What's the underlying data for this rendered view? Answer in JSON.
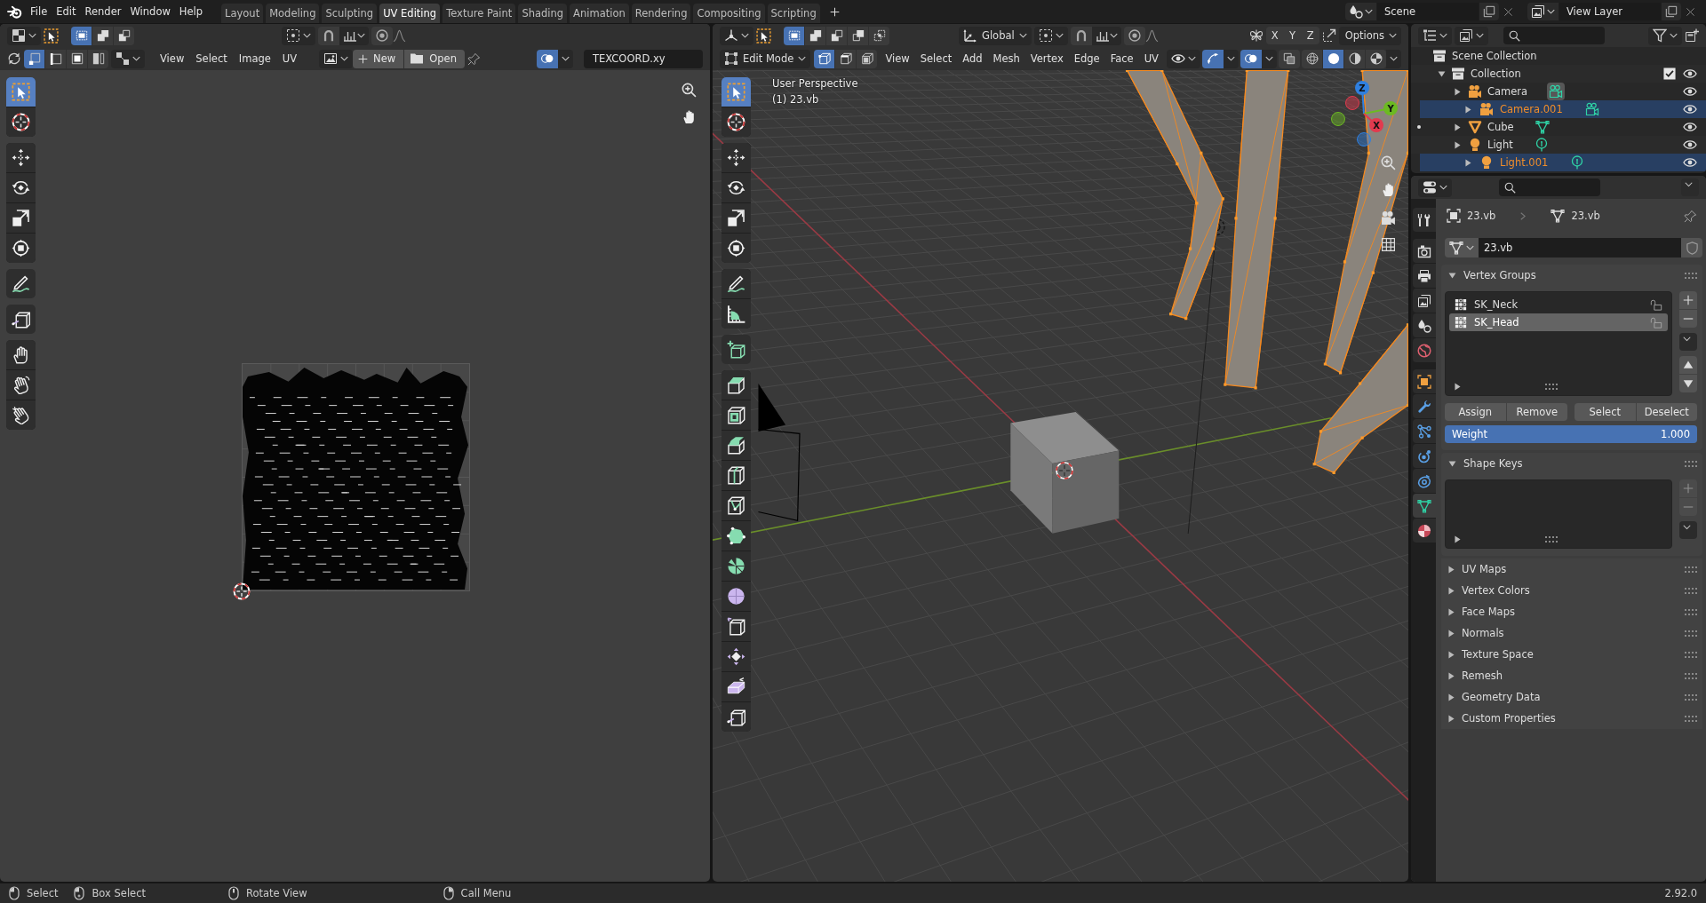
{
  "topbar": {
    "menus": [
      "File",
      "Edit",
      "Render",
      "Window",
      "Help"
    ],
    "workspaces": [
      {
        "label": "Layout",
        "selected": false
      },
      {
        "label": "Modeling",
        "selected": false
      },
      {
        "label": "Sculpting",
        "selected": false
      },
      {
        "label": "UV Editing",
        "selected": true
      },
      {
        "label": "Texture Paint",
        "selected": false
      },
      {
        "label": "Shading",
        "selected": false
      },
      {
        "label": "Animation",
        "selected": false
      },
      {
        "label": "Rendering",
        "selected": false
      },
      {
        "label": "Compositing",
        "selected": false
      },
      {
        "label": "Scripting",
        "selected": false
      }
    ],
    "scene": "Scene",
    "view_layer": "View Layer"
  },
  "uv_editor": {
    "select_modes": [
      {
        "kind": "set",
        "selected": true
      },
      {
        "kind": "extend",
        "selected": false
      },
      {
        "kind": "subtract",
        "selected": false
      }
    ],
    "uv_select_modes": [
      {
        "kind": "vertex",
        "selected": true
      },
      {
        "kind": "edge",
        "selected": false
      },
      {
        "kind": "face",
        "selected": false
      },
      {
        "kind": "island",
        "selected": false
      }
    ],
    "menus": [
      "View",
      "Select",
      "Image",
      "UV"
    ],
    "new_button": "New",
    "open_button": "Open",
    "overlays_on": true,
    "uv_map": "TEXCOORD.xy",
    "tool_groups": [
      {
        "tools": [
          {
            "kind": "select_box",
            "selected": true
          },
          {
            "kind": "cursor",
            "selected": false
          }
        ]
      },
      {
        "tools": [
          {
            "kind": "move",
            "selected": false
          },
          {
            "kind": "rotate",
            "selected": false
          },
          {
            "kind": "scale",
            "selected": false
          },
          {
            "kind": "transform",
            "selected": false
          }
        ]
      },
      {
        "tools": [
          {
            "kind": "annotate",
            "selected": false
          }
        ]
      },
      {
        "tools": [
          {
            "kind": "rip_region",
            "selected": false
          }
        ]
      },
      {
        "tools": [
          {
            "kind": "grab",
            "selected": false
          },
          {
            "kind": "relax",
            "selected": false
          },
          {
            "kind": "pinch",
            "selected": false
          }
        ]
      }
    ]
  },
  "viewport": {
    "select_modes": [
      {
        "kind": "set",
        "selected": true
      },
      {
        "kind": "extend",
        "selected": false
      },
      {
        "kind": "subtract",
        "selected": false
      },
      {
        "kind": "invert",
        "selected": false
      },
      {
        "kind": "intersect",
        "selected": false
      }
    ],
    "orientation": "Global",
    "mirror_axes": [
      {
        "label": "X",
        "on": false
      },
      {
        "label": "Y",
        "on": false
      },
      {
        "label": "Z",
        "on": false
      }
    ],
    "options": "Options",
    "mode": "Edit Mode",
    "mesh_select_modes": [
      {
        "kind": "vertex",
        "selected": true
      },
      {
        "kind": "edge",
        "selected": false
      },
      {
        "kind": "face",
        "selected": false
      }
    ],
    "menus": [
      "View",
      "Select",
      "Add",
      "Mesh",
      "Vertex",
      "Edge",
      "Face",
      "UV"
    ],
    "toggles": [
      {
        "kind": "gizmo",
        "on": true
      },
      {
        "kind": "overlays",
        "on": true
      },
      {
        "kind": "xray",
        "on": false
      }
    ],
    "shading_modes": [
      {
        "kind": "wireframe",
        "selected": false
      },
      {
        "kind": "solid",
        "selected": true
      },
      {
        "kind": "material",
        "selected": false
      },
      {
        "kind": "rendered",
        "selected": false
      }
    ],
    "view_name": "User Perspective",
    "object_info": "(1) 23.vb",
    "gizmo_axes": [
      {
        "kind": "z",
        "label": "Z",
        "color": "#2f80e0"
      },
      {
        "kind": "y",
        "label": "Y",
        "color": "#6cba22"
      },
      {
        "kind": "x",
        "label": "X",
        "color": "#e23a4e"
      }
    ],
    "tool_groups": [
      {
        "tools": [
          {
            "kind": "select_box",
            "selected": true
          },
          {
            "kind": "cursor",
            "selected": false
          }
        ]
      },
      {
        "tools": [
          {
            "kind": "move",
            "selected": false
          },
          {
            "kind": "rotate",
            "selected": false
          },
          {
            "kind": "scale",
            "selected": false
          },
          {
            "kind": "transform",
            "selected": false
          }
        ]
      },
      {
        "tools": [
          {
            "kind": "annotate",
            "selected": false
          },
          {
            "kind": "measure",
            "selected": false
          }
        ]
      },
      {
        "tools": [
          {
            "kind": "add_cube",
            "selected": false
          }
        ]
      },
      {
        "tools": [
          {
            "kind": "extrude",
            "selected": false
          },
          {
            "kind": "inset",
            "selected": false
          },
          {
            "kind": "bevel",
            "selected": false
          },
          {
            "kind": "loop_cut",
            "selected": false
          },
          {
            "kind": "knife",
            "selected": false
          },
          {
            "kind": "poly_build",
            "selected": false
          },
          {
            "kind": "spin",
            "selected": false
          },
          {
            "kind": "smooth",
            "selected": false
          },
          {
            "kind": "edge_slide",
            "selected": false
          },
          {
            "kind": "shrink_fatten",
            "selected": false
          },
          {
            "kind": "shear",
            "selected": false
          },
          {
            "kind": "rip_region",
            "selected": false
          }
        ]
      }
    ]
  },
  "outliner": {
    "root": "Scene Collection",
    "collections": [
      {
        "name": "Collection",
        "checked": true,
        "expanded": true,
        "children": [
          {
            "name": "Camera",
            "kind": "camera",
            "selected": false,
            "expanded": false,
            "mode_toggle": false,
            "active_data": true
          },
          {
            "name": "Camera.001",
            "kind": "camera",
            "selected": true,
            "expanded": false,
            "mode_toggle": false,
            "active_data": false
          },
          {
            "name": "Cube",
            "kind": "mesh",
            "selected": false,
            "expanded": false,
            "mode_toggle": true,
            "active_data": false
          },
          {
            "name": "Light",
            "kind": "light",
            "selected": false,
            "expanded": false,
            "mode_toggle": false,
            "active_data": false
          },
          {
            "name": "Light.001",
            "kind": "light",
            "selected": true,
            "expanded": false,
            "mode_toggle": false,
            "active_data": false
          }
        ]
      }
    ]
  },
  "properties": {
    "tab_groups": [
      {
        "tabs": [
          {
            "kind": "tool",
            "selected": false
          }
        ]
      },
      {
        "tabs": [
          {
            "kind": "render",
            "selected": false
          },
          {
            "kind": "output",
            "selected": false
          },
          {
            "kind": "view_layer",
            "selected": false
          },
          {
            "kind": "scene",
            "selected": false
          },
          {
            "kind": "world",
            "selected": false
          }
        ]
      },
      {
        "tabs": [
          {
            "kind": "object",
            "selected": false
          },
          {
            "kind": "modifiers",
            "selected": false
          },
          {
            "kind": "particles",
            "selected": false
          },
          {
            "kind": "physics",
            "selected": false
          },
          {
            "kind": "constraints",
            "selected": false
          },
          {
            "kind": "data",
            "selected": true
          },
          {
            "kind": "material",
            "selected": false
          }
        ]
      }
    ],
    "object_name": "23.vb",
    "data_name": "23.vb",
    "mesh_name": "23.vb",
    "panels": [
      {
        "kind": "vertex_groups",
        "title": "Vertex Groups",
        "expanded": true
      },
      {
        "kind": "shape_keys",
        "title": "Shape Keys",
        "expanded": true
      },
      {
        "title": "UV Maps",
        "expanded": false
      },
      {
        "title": "Vertex Colors",
        "expanded": false
      },
      {
        "title": "Face Maps",
        "expanded": false
      },
      {
        "title": "Normals",
        "expanded": false
      },
      {
        "title": "Texture Space",
        "expanded": false
      },
      {
        "title": "Remesh",
        "expanded": false
      },
      {
        "title": "Geometry Data",
        "expanded": false
      },
      {
        "title": "Custom Properties",
        "expanded": false
      }
    ],
    "vertex_groups": [
      {
        "name": "SK_Neck",
        "selected": false
      },
      {
        "name": "SK_Head",
        "selected": true
      }
    ],
    "group_buttons": [
      "Assign",
      "Remove",
      "Select",
      "Deselect"
    ],
    "weight": {
      "label": "Weight",
      "value": "1.000",
      "level": 1
    }
  },
  "status_bar": {
    "hints": [
      {
        "kind": "left",
        "label": "Select"
      },
      {
        "kind": "left_drag",
        "label": "Box Select"
      },
      {
        "kind": "middle",
        "label": "Rotate View"
      },
      {
        "kind": "right",
        "label": "Call Menu"
      }
    ],
    "version": "2.92.0"
  }
}
